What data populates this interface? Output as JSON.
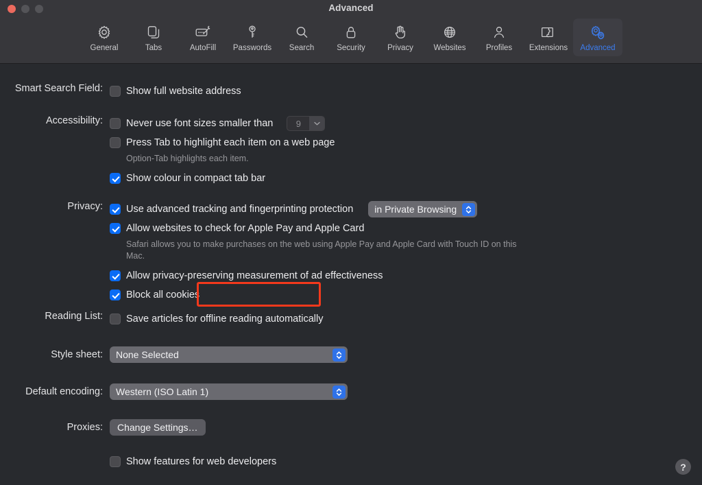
{
  "window": {
    "title": "Advanced",
    "traffic_lights": [
      {
        "name": "close",
        "color": "#ec6a5e"
      },
      {
        "name": "minimize",
        "color": "#545458"
      },
      {
        "name": "zoom",
        "color": "#545458"
      }
    ]
  },
  "toolbar": {
    "selected": "Advanced",
    "items": [
      {
        "label": "General",
        "icon": "gear-icon"
      },
      {
        "label": "Tabs",
        "icon": "tabs-icon"
      },
      {
        "label": "AutoFill",
        "icon": "autofill-pencil-icon"
      },
      {
        "label": "Passwords",
        "icon": "key-icon"
      },
      {
        "label": "Search",
        "icon": "magnifier-icon"
      },
      {
        "label": "Security",
        "icon": "lock-icon"
      },
      {
        "label": "Privacy",
        "icon": "hand-icon"
      },
      {
        "label": "Websites",
        "icon": "globe-icon"
      },
      {
        "label": "Profiles",
        "icon": "person-icon"
      },
      {
        "label": "Extensions",
        "icon": "puzzle-piece-icon"
      },
      {
        "label": "Advanced",
        "icon": "double-gear-icon"
      }
    ]
  },
  "settings": {
    "smart_search_field": {
      "label": "Smart Search Field:",
      "show_full_address": {
        "text": "Show full website address",
        "checked": false
      }
    },
    "accessibility": {
      "label": "Accessibility:",
      "never_use_font_sizes": {
        "text": "Never use font sizes smaller than",
        "checked": false
      },
      "font_size_value": "9",
      "press_tab": {
        "text": "Press Tab to highlight each item on a web page",
        "checked": false
      },
      "press_tab_hint": "Option-Tab highlights each item.",
      "show_colour": {
        "text": "Show colour in compact tab bar",
        "checked": true
      }
    },
    "privacy": {
      "label": "Privacy:",
      "advanced_tracking": {
        "text": "Use advanced tracking and fingerprinting protection",
        "checked": true
      },
      "tracking_scope": "in Private Browsing",
      "apple_pay": {
        "text": "Allow websites to check for Apple Pay and Apple Card",
        "checked": true
      },
      "apple_pay_hint": "Safari allows you to make purchases on the web using Apple Pay and Apple Card with Touch ID on this Mac.",
      "ad_measurement": {
        "text": "Allow privacy-preserving measurement of ad effectiveness",
        "checked": true
      },
      "block_cookies": {
        "text": "Block all cookies",
        "checked": true
      }
    },
    "reading_list": {
      "label": "Reading List:",
      "save_offline": {
        "text": "Save articles for offline reading automatically",
        "checked": false
      }
    },
    "style_sheet": {
      "label": "Style sheet:",
      "value": "None Selected"
    },
    "default_encoding": {
      "label": "Default encoding:",
      "value": "Western (ISO Latin 1)"
    },
    "proxies": {
      "label": "Proxies:",
      "button": "Change Settings…"
    },
    "web_developers": {
      "text": "Show features for web developers",
      "checked": false
    }
  },
  "annotation": {
    "target": "Block all cookies",
    "color": "#f4391c"
  },
  "help": {
    "label": "?"
  }
}
